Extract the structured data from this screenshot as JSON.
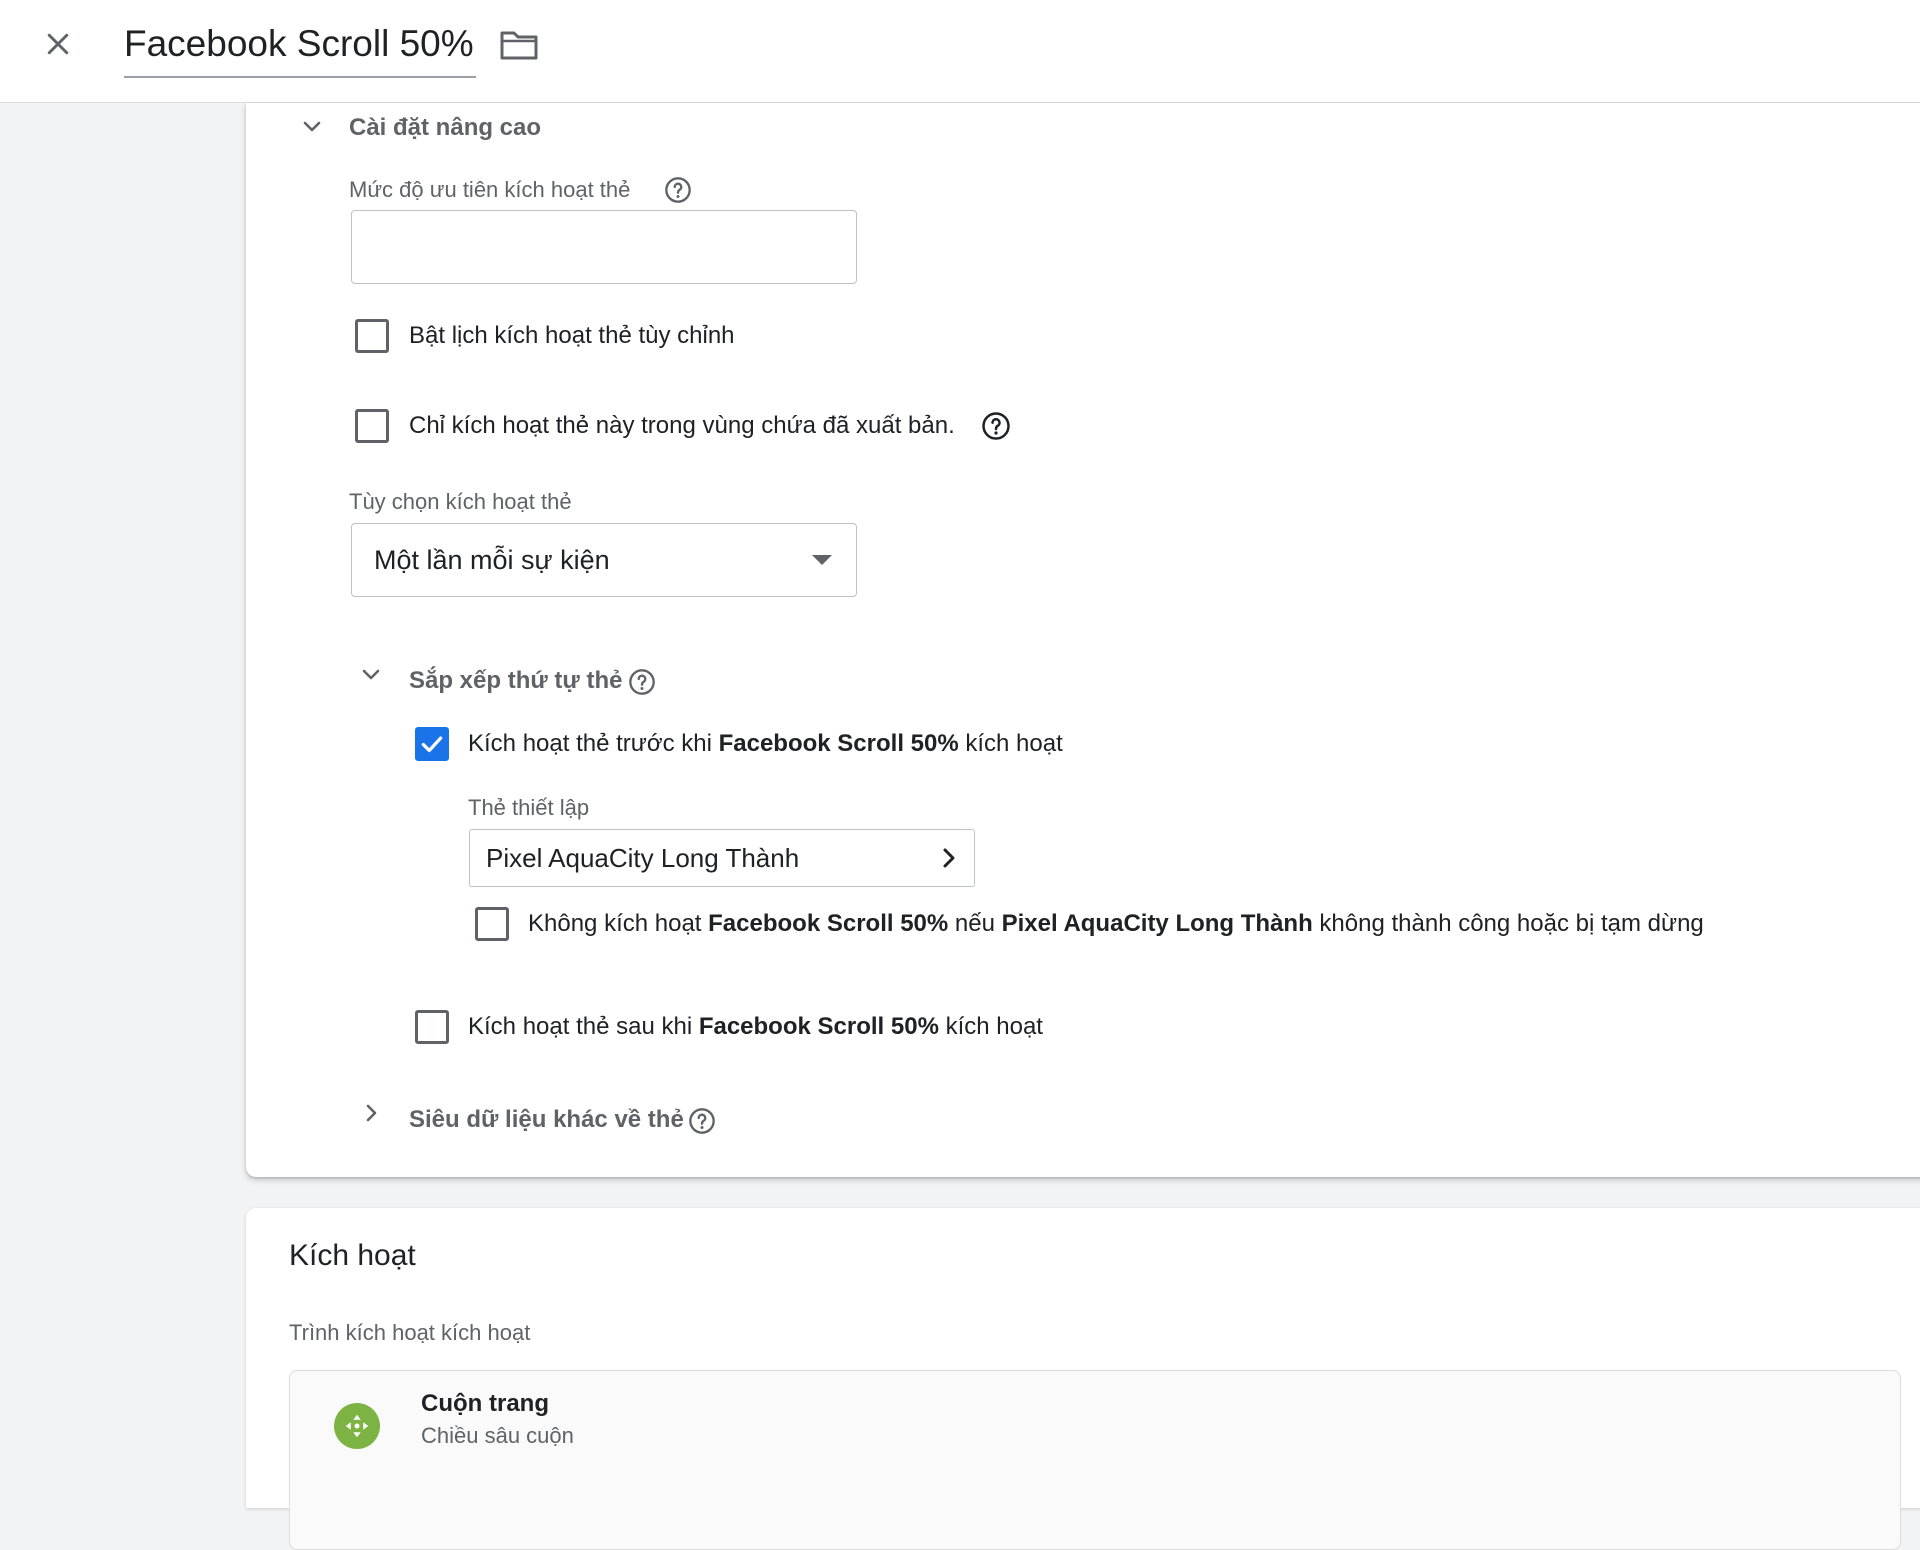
{
  "header": {
    "title": "Facebook Scroll 50%",
    "close_icon": "close-icon",
    "folder_icon": "folder-icon"
  },
  "advanced": {
    "section_title": "Cài đặt nâng cao",
    "priority": {
      "label": "Mức độ ưu tiên kích hoạt thẻ",
      "value": "",
      "placeholder": ""
    },
    "custom_schedule": {
      "label": "Bật lịch kích hoạt thẻ tùy chỉnh",
      "checked": false
    },
    "published_only": {
      "label": "Chỉ kích hoạt thẻ này trong vùng chứa đã xuất bản.",
      "checked": false
    },
    "firing_options": {
      "label": "Tùy chọn kích hoạt thẻ",
      "selected": "Một lần mỗi sự kiện"
    },
    "sequencing": {
      "title": "Sắp xếp thứ tự thẻ",
      "fire_before": {
        "prefix": "Kích hoạt thẻ trước khi ",
        "tag": "Facebook Scroll 50%",
        "suffix": " kích hoạt",
        "checked": true
      },
      "setup_tag": {
        "label": "Thẻ thiết lập",
        "value": "Pixel AquaCity Long Thành"
      },
      "dont_fire": {
        "prefix": "Không kích hoạt ",
        "tag": "Facebook Scroll 50%",
        "middle": " nếu ",
        "setup": "Pixel AquaCity Long Thành",
        "suffix": " không thành công hoặc bị tạm dừng",
        "checked": false
      },
      "fire_after": {
        "prefix": "Kích hoạt thẻ sau khi ",
        "tag": "Facebook Scroll 50%",
        "suffix": " kích hoạt",
        "checked": false
      }
    },
    "metadata": {
      "title": "Siêu dữ liệu khác về thẻ"
    }
  },
  "triggering": {
    "title": "Kích hoạt",
    "subtitle": "Trình kích hoạt kích hoạt",
    "trigger": {
      "name": "Cuộn trang",
      "type": "Chiều sâu cuộn",
      "icon": "scroll-arrows-icon",
      "icon_color": "#7cb342"
    }
  },
  "colors": {
    "accent": "#1a73e8",
    "text_secondary": "#5f6368"
  }
}
